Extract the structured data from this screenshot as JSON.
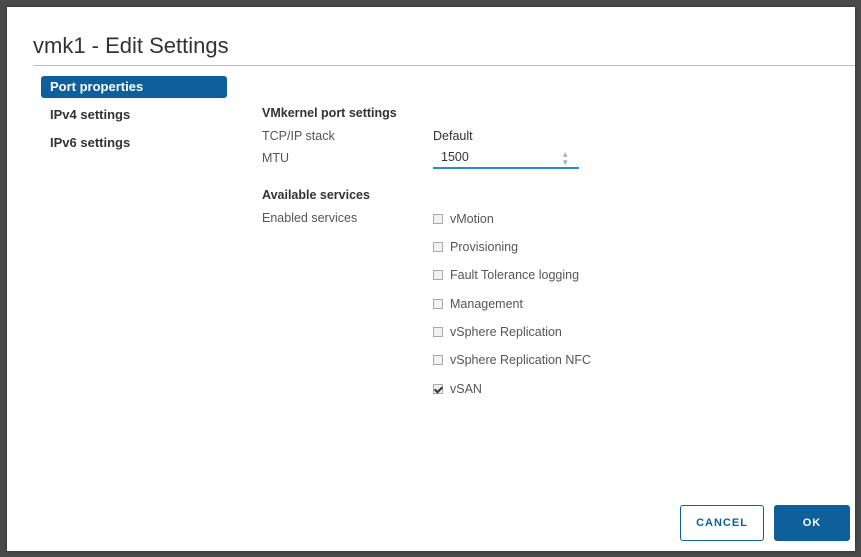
{
  "dialog": {
    "title": "vmk1 - Edit Settings",
    "nav": [
      {
        "label": "Port properties",
        "active": true
      },
      {
        "label": "IPv4 settings",
        "active": false
      },
      {
        "label": "IPv6 settings",
        "active": false
      }
    ],
    "port_settings": {
      "heading": "VMkernel port settings",
      "tcpip_label": "TCP/IP stack",
      "tcpip_value": "Default",
      "mtu_label": "MTU",
      "mtu_value": "1500"
    },
    "services": {
      "heading": "Available services",
      "enabled_label": "Enabled services",
      "items": [
        {
          "label": "vMotion",
          "checked": false
        },
        {
          "label": "Provisioning",
          "checked": false
        },
        {
          "label": "Fault Tolerance logging",
          "checked": false
        },
        {
          "label": "Management",
          "checked": false
        },
        {
          "label": "vSphere Replication",
          "checked": false
        },
        {
          "label": "vSphere Replication NFC",
          "checked": false
        },
        {
          "label": "vSAN",
          "checked": true
        }
      ]
    },
    "buttons": {
      "cancel": "CANCEL",
      "ok": "OK"
    },
    "colors": {
      "accent": "#0e5f9a",
      "focus": "#1d8ddc"
    }
  }
}
